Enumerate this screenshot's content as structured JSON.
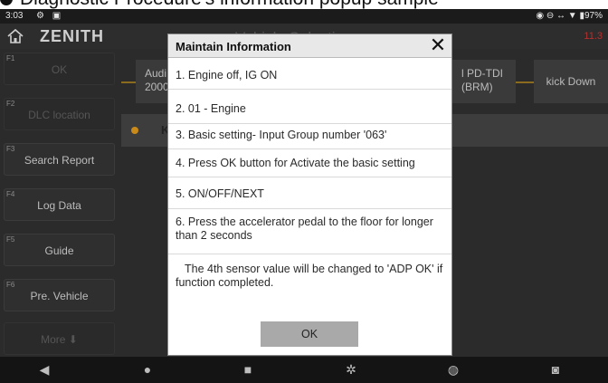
{
  "caption": {
    "text": "Diagnostic Procedure's information popup sample"
  },
  "status": {
    "time": "3:03",
    "icons": "⚙ ▣",
    "right": "◉ ⊖ ↔ ▼ ▮97%"
  },
  "header": {
    "logo": "ZENITH",
    "title": "Vehicle Selection",
    "right": "11.3"
  },
  "sidebar": {
    "items": [
      {
        "key": "F1",
        "label": "OK"
      },
      {
        "key": "F2",
        "label": "DLC location"
      },
      {
        "key": "F3",
        "label": "Search Report"
      },
      {
        "key": "F4",
        "label": "Log Data"
      },
      {
        "key": "F5",
        "label": "Guide"
      },
      {
        "key": "F6",
        "label": "Pre. Vehicle"
      },
      {
        "key": "",
        "label": "More ⬇"
      }
    ]
  },
  "background": {
    "card1": "Audi\n2000",
    "card2": "l PD-TDI\n(BRM)",
    "card3": "kick Down",
    "info": "K"
  },
  "dialog": {
    "title": "Maintain Information",
    "close": "✕",
    "lines": [
      "1. Engine off, IG ON",
      "2. 01 -  Engine",
      "3. Basic setting- Input Group number '063'",
      "4. Press OK button for Activate the basic setting",
      "5. ON/OFF/NEXT",
      "6. Press the accelerator pedal to the floor for longer than 2 seconds",
      "The 4th sensor value will be changed to 'ADP OK' if function completed."
    ],
    "ok_label": "OK"
  },
  "navbar": {
    "back": "◀",
    "home": "●",
    "recent": "■",
    "settings": "✲",
    "browser": "◍",
    "screenshot": "◙"
  },
  "colors": {
    "accent_line": "#8b6b1e",
    "indicator": "#c98a1a",
    "ok_button": "#a9a9a9"
  }
}
